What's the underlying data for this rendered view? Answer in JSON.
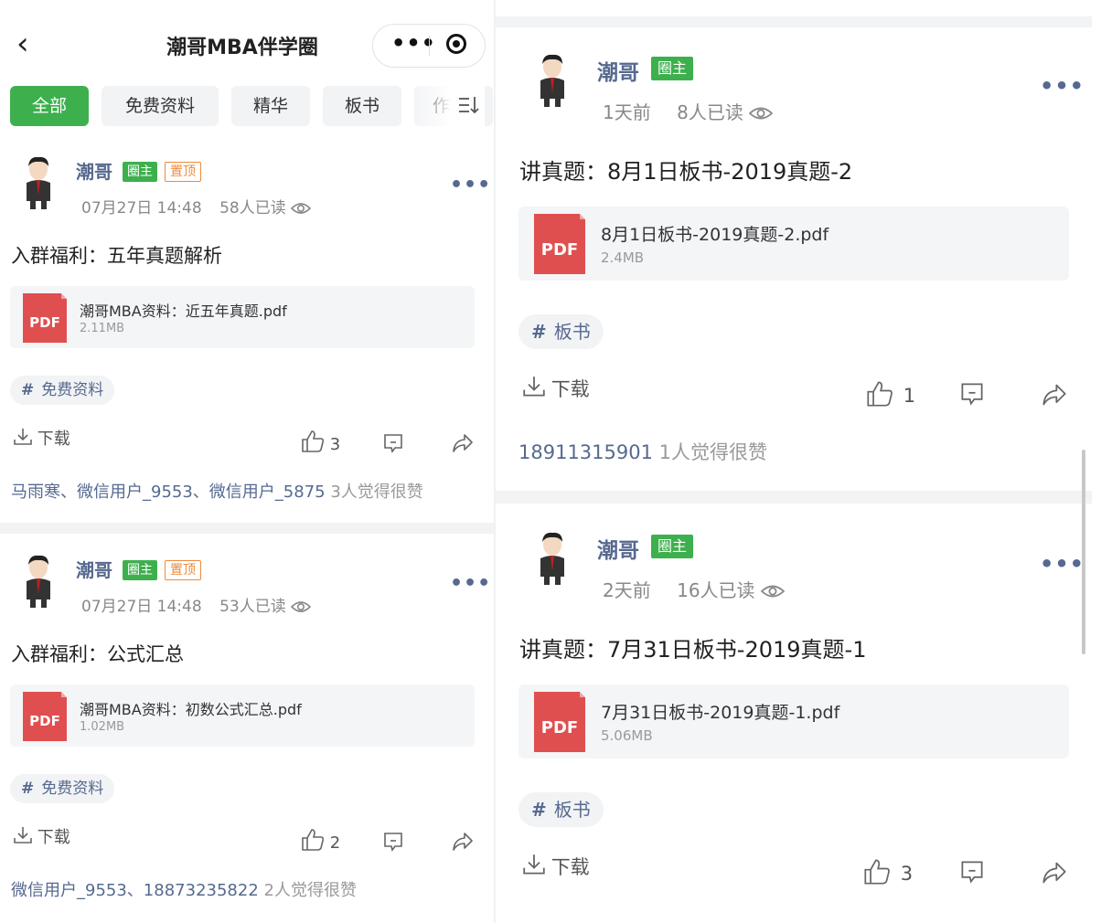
{
  "header": {
    "title": "潮哥MBA伴学圈",
    "back_icon": "‹"
  },
  "tabs": [
    {
      "label": "全部",
      "active": true
    },
    {
      "label": "免费资料",
      "active": false
    },
    {
      "label": "精华",
      "active": false
    },
    {
      "label": "板书",
      "active": false
    },
    {
      "label": "作",
      "active": false
    }
  ],
  "colors": {
    "accent": "#3db04d",
    "link": "#56698f",
    "pin": "#ee8a3a",
    "pdf": "#e04f4f"
  },
  "posts": [
    {
      "author": "潮哥",
      "owner_badge": "圈主",
      "pin_badge": "置顶",
      "date": "07月27日 14:48",
      "reads": "58人已读",
      "title": "入群福利：五年真题解析",
      "file_type": "PDF",
      "file_name": "潮哥MBA资料：近五年真题.pdf",
      "file_size": "2.11MB",
      "tag": "免费资料",
      "download": "下载",
      "like_count": "3",
      "likers": "马雨寒、微信用户_9553、微信用户_5875",
      "likes_suffix": "3人觉得很赞"
    },
    {
      "author": "潮哥",
      "owner_badge": "圈主",
      "pin_badge": "置顶",
      "date": "07月27日 14:48",
      "reads": "53人已读",
      "title": "入群福利：公式汇总",
      "file_type": "PDF",
      "file_name": "潮哥MBA资料：初数公式汇总.pdf",
      "file_size": "1.02MB",
      "tag": "免费资料",
      "download": "下载",
      "like_count": "2",
      "likers": "微信用户_9553、18873235822",
      "likes_suffix": "2人觉得很赞"
    },
    {
      "author": "潮哥",
      "owner_badge": "圈主",
      "date": "1天前",
      "reads": "8人已读",
      "title": "讲真题：8月1日板书-2019真题-2",
      "file_type": "PDF",
      "file_name": "8月1日板书-2019真题-2.pdf",
      "file_size": "2.4MB",
      "tag": "板书",
      "download": "下载",
      "like_count": "1",
      "likers": "18911315901",
      "likes_suffix": "1人觉得很赞"
    },
    {
      "author": "潮哥",
      "owner_badge": "圈主",
      "date": "2天前",
      "reads": "16人已读",
      "title": "讲真题：7月31日板书-2019真题-1",
      "file_type": "PDF",
      "file_name": "7月31日板书-2019真题-1.pdf",
      "file_size": "5.06MB",
      "tag": "板书",
      "download": "下载",
      "like_count": "3"
    }
  ]
}
